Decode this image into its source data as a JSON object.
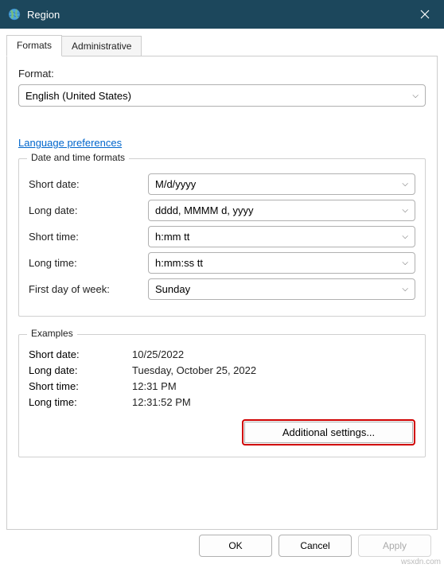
{
  "titlebar": {
    "title": "Region"
  },
  "tabs": {
    "formats": "Formats",
    "administrative": "Administrative"
  },
  "format": {
    "label": "Format:",
    "value": "English (United States)"
  },
  "link": {
    "language_prefs": "Language preferences"
  },
  "date_time_formats": {
    "group_title": "Date and time formats",
    "short_date_label": "Short date:",
    "short_date_value": "M/d/yyyy",
    "long_date_label": "Long date:",
    "long_date_value": "dddd, MMMM d, yyyy",
    "short_time_label": "Short time:",
    "short_time_value": "h:mm tt",
    "long_time_label": "Long time:",
    "long_time_value": "h:mm:ss tt",
    "first_day_label": "First day of week:",
    "first_day_value": "Sunday"
  },
  "examples": {
    "group_title": "Examples",
    "short_date_label": "Short date:",
    "short_date_value": "10/25/2022",
    "long_date_label": "Long date:",
    "long_date_value": "Tuesday, October 25, 2022",
    "short_time_label": "Short time:",
    "short_time_value": "12:31 PM",
    "long_time_label": "Long time:",
    "long_time_value": "12:31:52 PM"
  },
  "buttons": {
    "additional_settings": "Additional settings...",
    "ok": "OK",
    "cancel": "Cancel",
    "apply": "Apply"
  },
  "watermark": "wsxdn.com"
}
